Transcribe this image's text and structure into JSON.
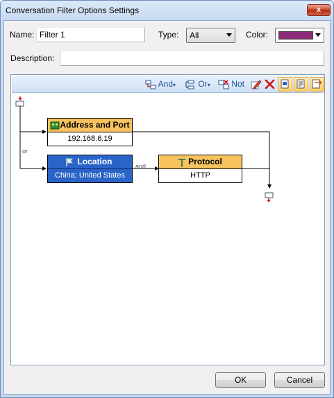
{
  "window": {
    "title": "Conversation Filter Options Settings",
    "close_glyph": "x"
  },
  "form": {
    "name_label": "Name:",
    "name_value": "Filter 1",
    "type_label": "Type:",
    "type_value": "All",
    "color_label": "Color:",
    "color_value": "#8d2a78",
    "description_label": "Description:",
    "description_value": ""
  },
  "toolbar": {
    "and_label": "And",
    "or_label": "Or",
    "not_label": "Not",
    "edit_icon": "pencil-icon",
    "delete_icon": "red-x-icon"
  },
  "diagram": {
    "nodes": [
      {
        "title": "Address and Port",
        "value": "192.168.6.19",
        "color": "#f6c35f",
        "icon": "network-card-icon"
      },
      {
        "title": "Location",
        "value": "China; United States",
        "color": "#2a64c8",
        "icon": "flag-icon"
      },
      {
        "title": "Protocol",
        "value": "HTTP",
        "color": "#f6c35f",
        "icon": "protocol-icon"
      }
    ],
    "or_label": "or",
    "and_label": "and"
  },
  "buttons": {
    "ok": "OK",
    "cancel": "Cancel"
  }
}
